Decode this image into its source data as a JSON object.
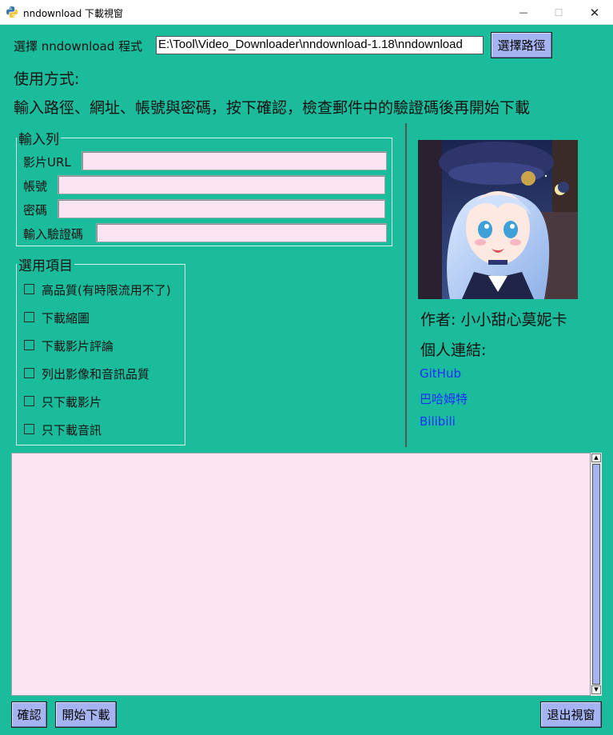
{
  "window": {
    "title": "nndownload 下載視窗",
    "minimize": "—",
    "maximize": "☐",
    "close": "✕"
  },
  "path": {
    "label": "選擇 nndownload 程式",
    "value": "E:\\Tool\\Video_Downloader\\nndownload-1.18\\nndownload",
    "button": "選擇路徑"
  },
  "usage": {
    "title": "使用方式:",
    "text": "輸入路徑、網址、帳號與密碼，按下確認，檢查郵件中的驗證碼後再開始下載"
  },
  "input_group": {
    "legend": "輸入列",
    "fields": [
      {
        "label": "影片URL",
        "value": ""
      },
      {
        "label": "帳號",
        "value": ""
      },
      {
        "label": "密碼",
        "value": ""
      },
      {
        "label": "輸入驗證碼",
        "value": ""
      }
    ]
  },
  "options_group": {
    "legend": "選用項目",
    "items": [
      {
        "label": "高品質(有時限流用不了)",
        "checked": false
      },
      {
        "label": "下載縮圖",
        "checked": false
      },
      {
        "label": "下載影片評論",
        "checked": false
      },
      {
        "label": "列出影像和音訊品質",
        "checked": false
      },
      {
        "label": "只下載影片",
        "checked": false
      },
      {
        "label": "只下載音訊",
        "checked": false
      }
    ]
  },
  "sidebar": {
    "author": "作者: 小小甜心莫妮卡",
    "links_title": "個人連結:",
    "links": [
      "GitHub",
      "巴哈姆特",
      "Bilibili"
    ]
  },
  "log": {
    "content": ""
  },
  "buttons": {
    "confirm": "確認",
    "start": "開始下載",
    "exit": "退出視窗"
  },
  "colors": {
    "background": "#1abc9c",
    "button": "#a5b4f0",
    "input": "#fce4f2",
    "link": "#1a2cff"
  }
}
